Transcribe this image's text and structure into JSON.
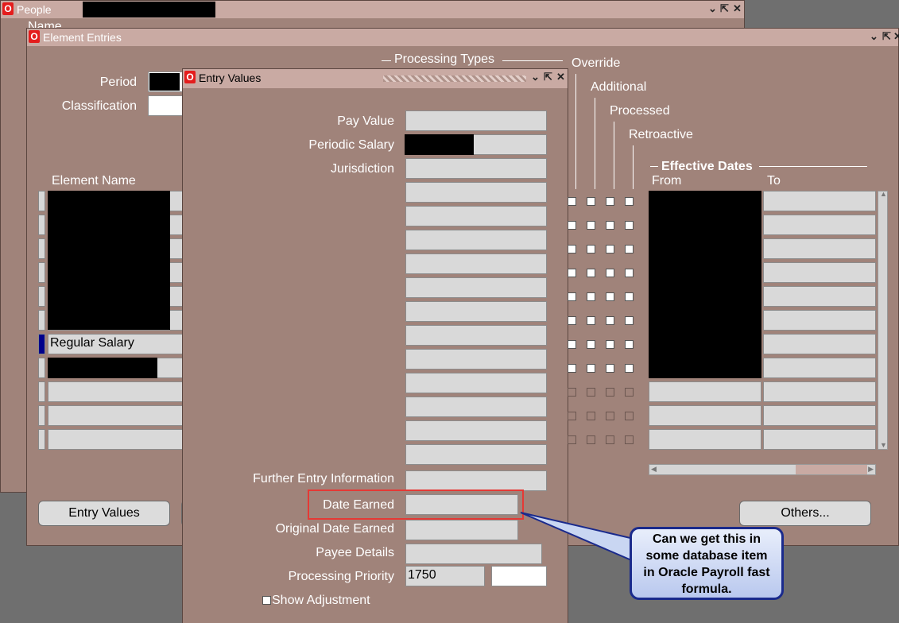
{
  "windows": {
    "people": {
      "title": "People",
      "name_label": "Name"
    },
    "element_entries": {
      "title": "Element Entries",
      "period_label": "Period",
      "classification_label": "Classification",
      "processing_types_label": "Processing Types",
      "override_label": "Override",
      "additional_label": "Additional",
      "processed_label": "Processed",
      "retroactive_label": "Retroactive",
      "effective_dates_label": "Effective Dates",
      "from_label": "From",
      "to_label": "To",
      "element_name_label": "Element Name",
      "selected_element": "Regular Salary",
      "entry_values_button": "Entry Values",
      "others_button": "Others..."
    },
    "entry_values": {
      "title": "Entry Values",
      "labels": {
        "pay_value": "Pay Value",
        "periodic_salary": "Periodic Salary",
        "jurisdiction": "Jurisdiction",
        "further_entry_information": "Further Entry Information",
        "date_earned": "Date Earned",
        "original_date_earned": "Original Date Earned",
        "payee_details": "Payee Details",
        "processing_priority": "Processing Priority",
        "show_adjustment": "Show Adjustment"
      },
      "processing_priority_value": "1750"
    }
  },
  "callout": {
    "line1": "Can we get this in",
    "line2": "some database item",
    "line3": "in Oracle Payroll fast",
    "line4": "formula."
  },
  "colors": {
    "window_bg": "#a0837a",
    "titlebar": "#c9aaa3",
    "highlight_box": "#e53935",
    "callout_border": "#1a2a8c",
    "active_row_marker": "#00008b"
  }
}
